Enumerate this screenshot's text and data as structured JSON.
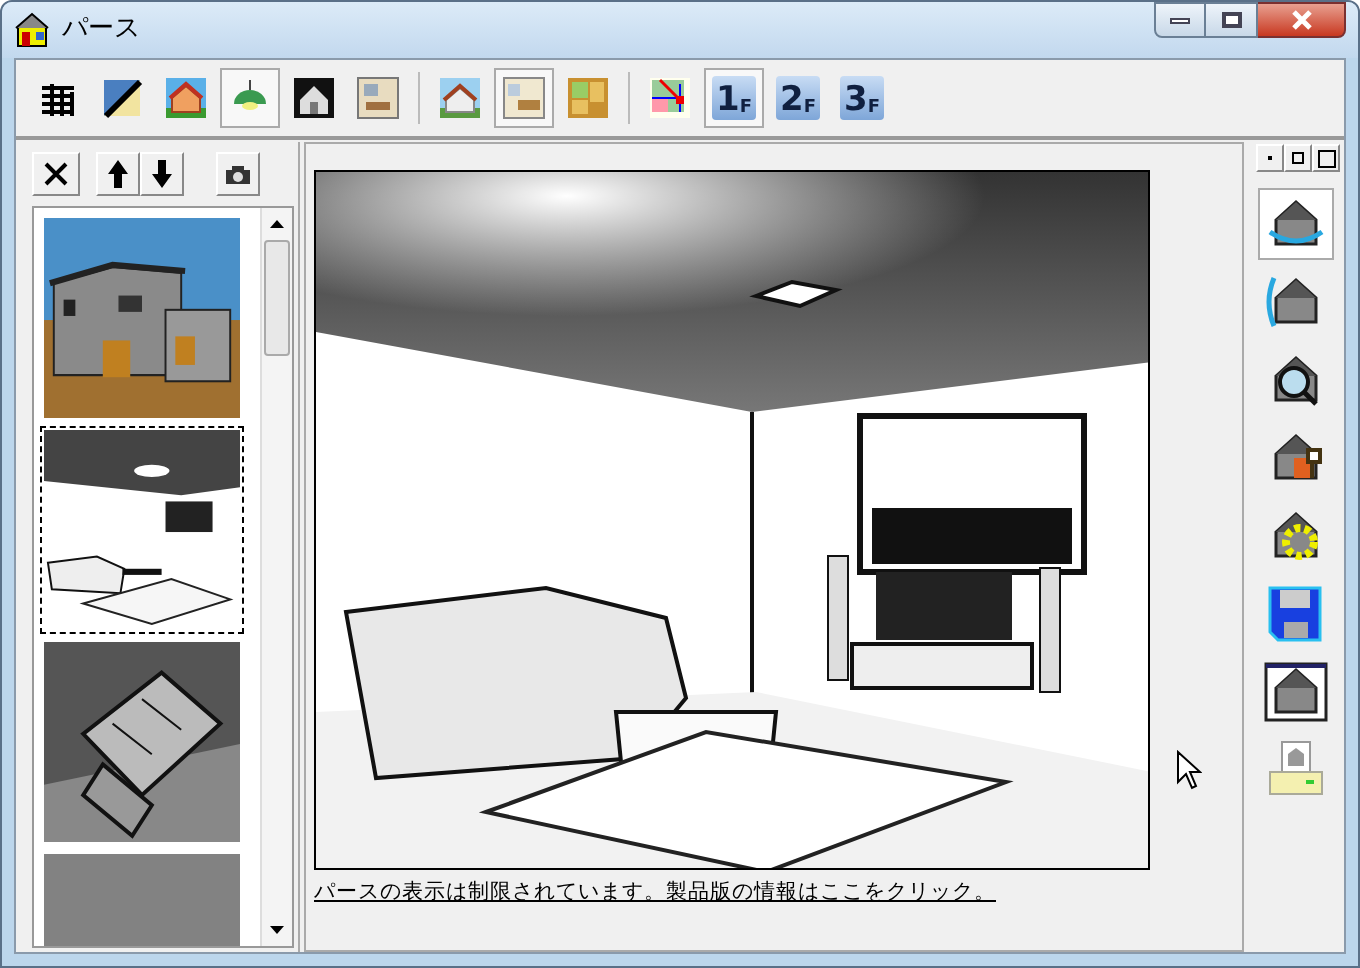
{
  "window": {
    "title": "パース"
  },
  "toolbar": [
    {
      "kind": "icon",
      "selected": false
    },
    {
      "kind": "icon",
      "selected": false
    },
    {
      "kind": "icon",
      "selected": false
    },
    {
      "kind": "icon",
      "selected": true
    },
    {
      "kind": "icon",
      "selected": false
    },
    {
      "kind": "icon",
      "selected": false
    },
    {
      "kind": "separator"
    },
    {
      "kind": "icon",
      "selected": false
    },
    {
      "kind": "icon",
      "selected": true
    },
    {
      "kind": "icon",
      "selected": false
    },
    {
      "kind": "separator"
    },
    {
      "kind": "icon",
      "selected": false
    },
    {
      "kind": "floor",
      "number": "1",
      "suffix": "F",
      "selected": true
    },
    {
      "kind": "floor",
      "number": "2",
      "suffix": "F",
      "selected": false
    },
    {
      "kind": "floor",
      "number": "3",
      "suffix": "F",
      "selected": false
    }
  ],
  "thumbnails": [
    {
      "kind": "exterior",
      "selected": false
    },
    {
      "kind": "interior",
      "selected": true
    },
    {
      "kind": "aerial",
      "selected": false
    },
    {
      "kind": "blank",
      "selected": false
    }
  ],
  "view": {
    "notice_link": "パースの表示は制限されています。製品版の情報はここをクリック。"
  },
  "tools": [
    {
      "selected": true
    },
    {
      "selected": false
    },
    {
      "selected": false
    },
    {
      "selected": false
    },
    {
      "selected": false
    },
    {
      "selected": false
    },
    {
      "selected": false
    },
    {
      "selected": false
    }
  ]
}
